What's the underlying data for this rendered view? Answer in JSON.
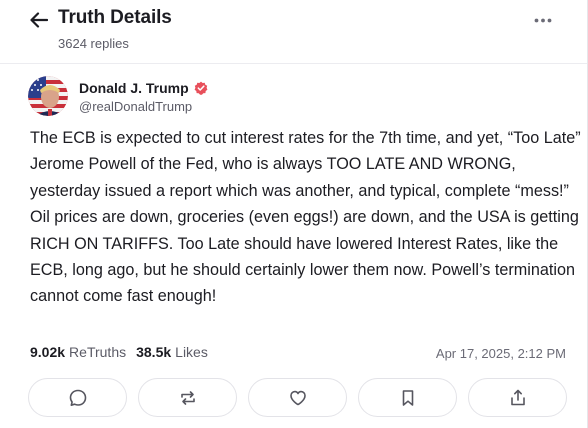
{
  "header": {
    "title": "Truth Details",
    "replies_count": "3624 replies",
    "back_icon": "arrow-left-icon",
    "more_icon": "ellipsis-icon"
  },
  "post": {
    "author": {
      "display_name": "Donald J. Trump",
      "handle": "@realDonaldTrump",
      "verified": true,
      "verified_color": "#e8505b"
    },
    "text": "The ECB is expected to cut interest rates for the 7th time, and yet, “Too Late” Jerome Powell of the Fed, who is always TOO LATE AND WRONG, yesterday issued a report which was another, and typical, complete “mess!” Oil prices are down, groceries (even eggs!) are down, and the USA is getting RICH ON TARIFFS. Too Late should have lowered Interest Rates, like the ECB, long ago, but he should certainly lower them now. Powell’s termination cannot come fast enough!",
    "stats": {
      "retruths_count": "9.02k",
      "retruths_label": "ReTruths",
      "likes_count": "38.5k",
      "likes_label": "Likes"
    },
    "timestamp": "Apr 17, 2025, 2:12 PM"
  },
  "actions": [
    {
      "name": "reply",
      "icon": "comment-icon"
    },
    {
      "name": "retruth",
      "icon": "repost-icon"
    },
    {
      "name": "like",
      "icon": "heart-icon"
    },
    {
      "name": "bookmark",
      "icon": "bookmark-icon"
    },
    {
      "name": "share",
      "icon": "share-icon"
    }
  ],
  "colors": {
    "text_primary": "#1c1c22",
    "text_secondary": "#5b5b66",
    "border": "#e3e3e8",
    "icon": "#56565f"
  }
}
